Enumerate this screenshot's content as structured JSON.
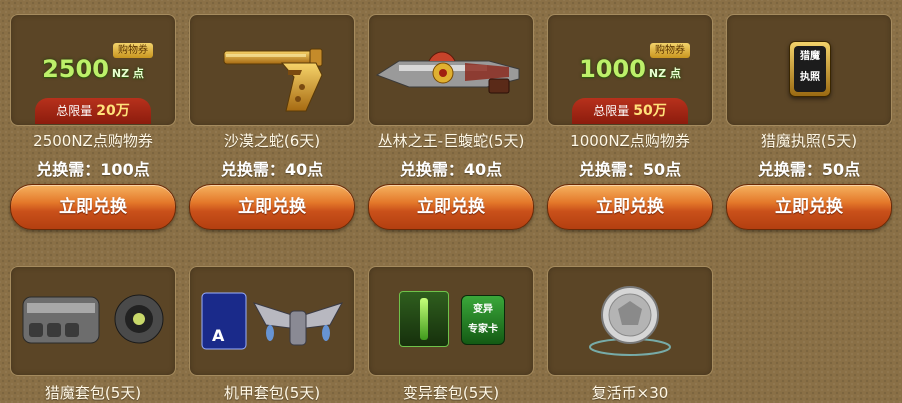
{
  "exchange_button_label": "立即兑换",
  "items": [
    {
      "name": "2500NZ点购物券",
      "cost": "兑换需：100点",
      "art": {
        "amount": "2500",
        "unit": "NZ 点",
        "tag": "购物券",
        "limit_label": "总限量",
        "limit_value": "20万"
      }
    },
    {
      "name": "沙漠之蛇(6天)",
      "cost": "兑换需：40点"
    },
    {
      "name": "丛林之王-巨蝮蛇(5天)",
      "cost": "兑换需：40点"
    },
    {
      "name": "1000NZ点购物券",
      "cost": "兑换需：50点",
      "art": {
        "amount": "1000",
        "unit": "NZ 点",
        "tag": "购物券",
        "limit_label": "总限量",
        "limit_value": "50万"
      }
    },
    {
      "name": "猎魔执照(5天)",
      "cost": "兑换需：50点",
      "art": {
        "badge_line1": "猎魔",
        "badge_line2": "执照"
      }
    },
    {
      "name": "猎魔套包(5天)"
    },
    {
      "name": "机甲套包(5天)"
    },
    {
      "name": "变异套包(5天)",
      "art": {
        "badge_line1": "变异",
        "badge_line2": "专家卡"
      }
    },
    {
      "name": "复活币×30"
    }
  ]
}
